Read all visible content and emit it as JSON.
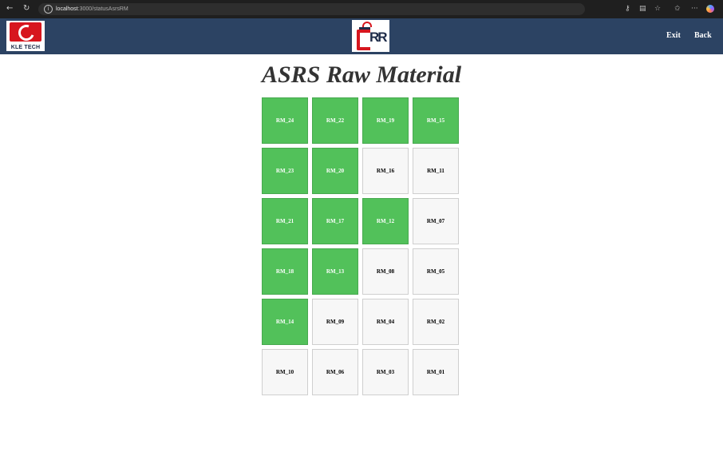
{
  "browser": {
    "url_host": "localhost",
    "url_path": ":3000/statusAsrsRM"
  },
  "header": {
    "left_logo_text": "KLE TECH",
    "exit_label": "Exit",
    "back_label": "Back"
  },
  "page": {
    "title": "ASRS Raw Material"
  },
  "colors": {
    "occupied": "#52c15a",
    "empty": "#f7f7f7",
    "header": "#2c4363"
  },
  "racks": [
    {
      "label": "RM_24",
      "occupied": true
    },
    {
      "label": "RM_22",
      "occupied": true
    },
    {
      "label": "RM_19",
      "occupied": true
    },
    {
      "label": "RM_15",
      "occupied": true
    },
    {
      "label": "RM_23",
      "occupied": true
    },
    {
      "label": "RM_20",
      "occupied": true
    },
    {
      "label": "RM_16",
      "occupied": false
    },
    {
      "label": "RM_11",
      "occupied": false
    },
    {
      "label": "RM_21",
      "occupied": true
    },
    {
      "label": "RM_17",
      "occupied": true
    },
    {
      "label": "RM_12",
      "occupied": true
    },
    {
      "label": "RM_07",
      "occupied": false
    },
    {
      "label": "RM_18",
      "occupied": true
    },
    {
      "label": "RM_13",
      "occupied": true
    },
    {
      "label": "RM_08",
      "occupied": false
    },
    {
      "label": "RM_05",
      "occupied": false
    },
    {
      "label": "RM_14",
      "occupied": true
    },
    {
      "label": "RM_09",
      "occupied": false
    },
    {
      "label": "RM_04",
      "occupied": false
    },
    {
      "label": "RM_02",
      "occupied": false
    },
    {
      "label": "RM_10",
      "occupied": false
    },
    {
      "label": "RM_06",
      "occupied": false
    },
    {
      "label": "RM_03",
      "occupied": false
    },
    {
      "label": "RM_01",
      "occupied": false
    }
  ]
}
